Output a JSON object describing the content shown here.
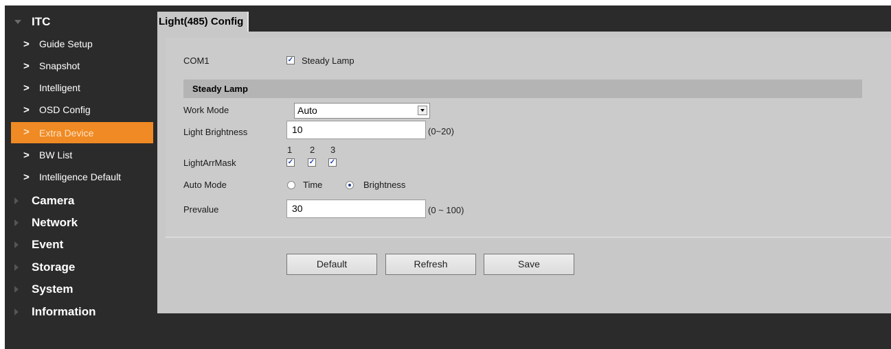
{
  "sidebar": {
    "itc": "ITC",
    "items": [
      "Guide Setup",
      "Snapshot",
      "Intelligent",
      "OSD Config",
      "Extra Device",
      "BW List",
      "Intelligence Default"
    ],
    "active": "Extra Device",
    "sections": [
      "Camera",
      "Network",
      "Event",
      "Storage",
      "System",
      "Information"
    ]
  },
  "page": {
    "title": "Light(485) Config"
  },
  "form": {
    "com_label": "COM1",
    "steady_lamp_checkbox_label": "Steady Lamp",
    "steady_lamp_checked": true,
    "section_title": "Steady Lamp",
    "work_mode_label": "Work Mode",
    "work_mode_value": "Auto",
    "light_brightness_label": "Light Brightness",
    "light_brightness_value": "10",
    "light_brightness_range": "(0~20)",
    "mask_label": "LightArrMask",
    "mask_numbers": [
      "1",
      "2",
      "3"
    ],
    "auto_mode_label": "Auto Mode",
    "auto_mode_time": "Time",
    "auto_mode_brightness": "Brightness",
    "auto_mode_selected": "Brightness",
    "prevalue_label": "Prevalue",
    "prevalue_value": "30",
    "prevalue_range": "(0 ~ 100)"
  },
  "buttons": {
    "default": "Default",
    "refresh": "Refresh",
    "save": "Save"
  },
  "colors": {
    "active": "#f08a24",
    "frame": "#2b2b2b",
    "panel": "#c8c8c8"
  }
}
